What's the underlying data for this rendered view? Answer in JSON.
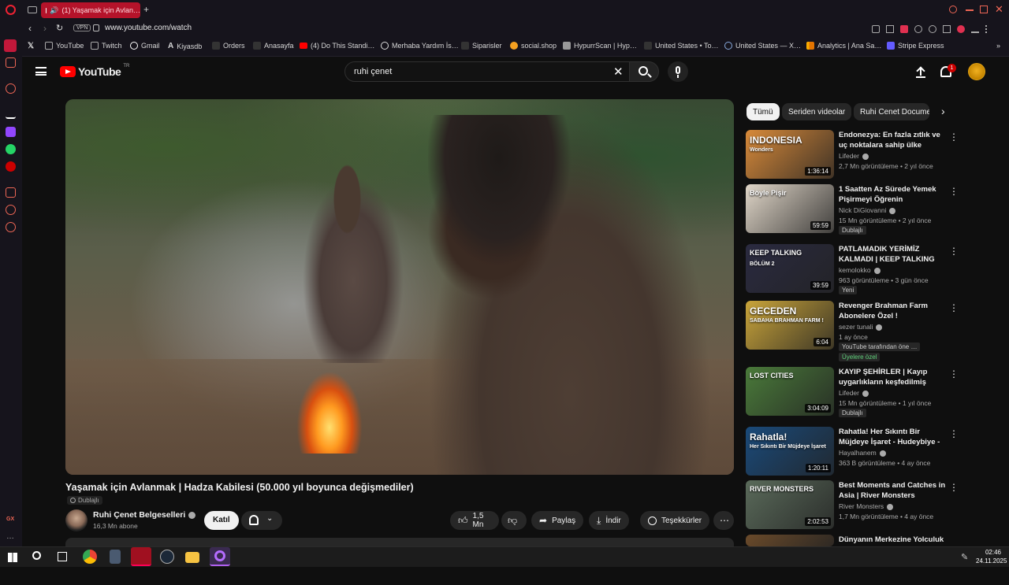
{
  "browser": {
    "tab_title": "(1) Yaşamak için Avlan…",
    "url": "www.youtube.com/watch",
    "vpn": "VPN",
    "bookmarks": [
      "YouTube",
      "Twitch",
      "Gmail",
      "Kiyasdb",
      "Orders",
      "Anasayfa",
      "(4) Do This Standi…",
      "Merhaba Yardım İs…",
      "Siparisler",
      "social.shop",
      "HypurrScan | Hyp…",
      "United States • To…",
      "United States — X…",
      "Analytics | Ana Sa…",
      "Stripe Express"
    ]
  },
  "youtube": {
    "logo": "YouTube",
    "region": "TR",
    "search_value": "ruhi çenet",
    "notification_count": "1"
  },
  "video": {
    "title": "Yaşamak için Avlanmak | Hadza Kabilesi (50.000 yıl boyunca değişmediler)",
    "dubbed": "Dublajlı",
    "channel": "Ruhi Çenet Belgeselleri",
    "subscribers": "16,3 Mn abone",
    "join": "Katıl",
    "likes": "1,5 Mn",
    "share": "Paylaş",
    "download": "İndir",
    "thanks": "Teşekkürler"
  },
  "chips": [
    "Tümü",
    "Seriden videolar",
    "Ruhi Cenet Documen"
  ],
  "recommendations": [
    {
      "title": "Endonezya: En fazla zıtlık ve uç noktalara sahip ülke",
      "channel": "Lifeder",
      "meta": "2,7 Mn görüntüleme • 2 yıl önce",
      "duration": "1:36:14",
      "badge": "",
      "thumb_text": "INDONESIA",
      "thumb_sub": "Wonders",
      "color": "#d88a3a"
    },
    {
      "title": "1 Saatten Az Sürede Yemek Pişirmeyi Öğrenin",
      "channel": "Nick DiGiovanni",
      "meta": "15 Mn görüntüleme • 2 yıl önce",
      "duration": "59:59",
      "badge": "Dublajlı",
      "thumb_text": "Böyle Pişir",
      "thumb_sub": "",
      "color": "#e0d6c8"
    },
    {
      "title": "PATLAMADIK YERİMİZ KALMADI | KEEP TALKING AN…",
      "channel": "kemolokko",
      "meta": "963 görüntüleme • 3 gün önce",
      "duration": "39:59",
      "badge": "Yeni",
      "thumb_text": "KEEP TALKING",
      "thumb_sub": "BÖLÜM 2",
      "color": "#2a2a40"
    },
    {
      "title": "Revenger Brahman Farm Abonelere Özel !",
      "channel": "sezer tunali",
      "meta": "1 ay önce",
      "duration": "6:04",
      "badge": "YouTube tarafından öne …",
      "badge2": "Üyelere özel",
      "thumb_text": "GECEDEN",
      "thumb_sub": "SABAHA BRAHMAN FARM !",
      "color": "#c9a43a"
    },
    {
      "title": "KAYIP ŞEHİRLER | Kayıp uygarlıkların keşfedilmiş yerleri",
      "channel": "Lifeder",
      "meta": "15 Mn görüntüleme • 1 yıl önce",
      "duration": "3:04:09",
      "badge": "Dublajlı",
      "thumb_text": "LOST CITIES",
      "thumb_sub": "",
      "color": "#4a7a3a"
    },
    {
      "title": "Rahatla! Her Sıkıntı Bir Müjdeye İşaret - Hudeybiye -Bölüm …",
      "channel": "Hayalhanem",
      "meta": "363 B görüntüleme • 4 ay önce",
      "duration": "1:20:11",
      "badge": "",
      "thumb_text": "Rahatla!",
      "thumb_sub": "Her Sıkıntı Bir Müjdeye İşaret",
      "color": "#1a4a7a"
    },
    {
      "title": "Best Moments and Catches in Asia | River Monsters",
      "channel": "River Monsters",
      "meta": "1,7 Mn görüntüleme • 4 ay önce",
      "duration": "2:02:53",
      "badge": "",
      "thumb_text": "RIVER MONSTERS",
      "thumb_sub": "",
      "color": "#5a6a5a"
    },
    {
      "title": "Dünyanın Merkezine Yolculuk",
      "channel": "",
      "meta": "",
      "duration": "",
      "badge": "",
      "thumb_text": "",
      "thumb_sub": "",
      "color": "#6a4a2a"
    }
  ],
  "taskbar": {
    "time": "02:46",
    "date": "24.11.2025"
  },
  "sidebar_bottom": "GX"
}
